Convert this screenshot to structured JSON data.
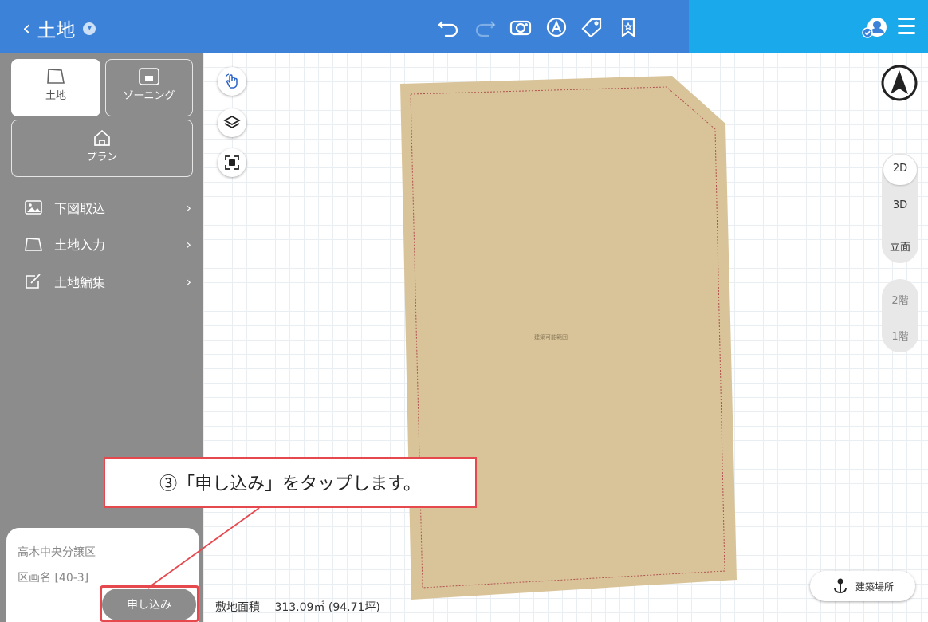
{
  "header": {
    "back_label": "土地",
    "toolbar_icons": [
      "undo-icon",
      "redo-icon",
      "camera-icon",
      "annotate-icon",
      "tag-icon",
      "bookmark-icon"
    ],
    "colors": {
      "left": "#3b82d8",
      "right": "#1aa9ea"
    }
  },
  "sidebar": {
    "tabs": [
      {
        "label": "土地",
        "icon": "land-shape-icon",
        "active": true
      },
      {
        "label": "ゾーニング",
        "icon": "zoning-icon",
        "active": false
      },
      {
        "label": "プラン",
        "icon": "home-icon",
        "active": false
      }
    ],
    "items": [
      {
        "label": "下図取込",
        "icon": "image-icon"
      },
      {
        "label": "土地入力",
        "icon": "land-shape-icon"
      },
      {
        "label": "土地編集",
        "icon": "edit-icon"
      }
    ],
    "info": {
      "subdivision": "高木中央分譲区",
      "lot": "区画名 [40-3]"
    },
    "apply_label": "申し込み"
  },
  "canvas": {
    "plot_label": "建築可能範囲",
    "plot_color": "#d9c49a",
    "site_area_label": "敷地面積",
    "site_area_value": "313.09㎡ (94.71坪)",
    "view_modes": [
      "2D",
      "3D",
      "立面"
    ],
    "selected_view": "2D",
    "floors": [
      "2階",
      "1階"
    ],
    "site_button_label": "建築場所"
  },
  "annotation": {
    "text": "③「申し込み」をタップします。",
    "color": "#e5484d"
  }
}
